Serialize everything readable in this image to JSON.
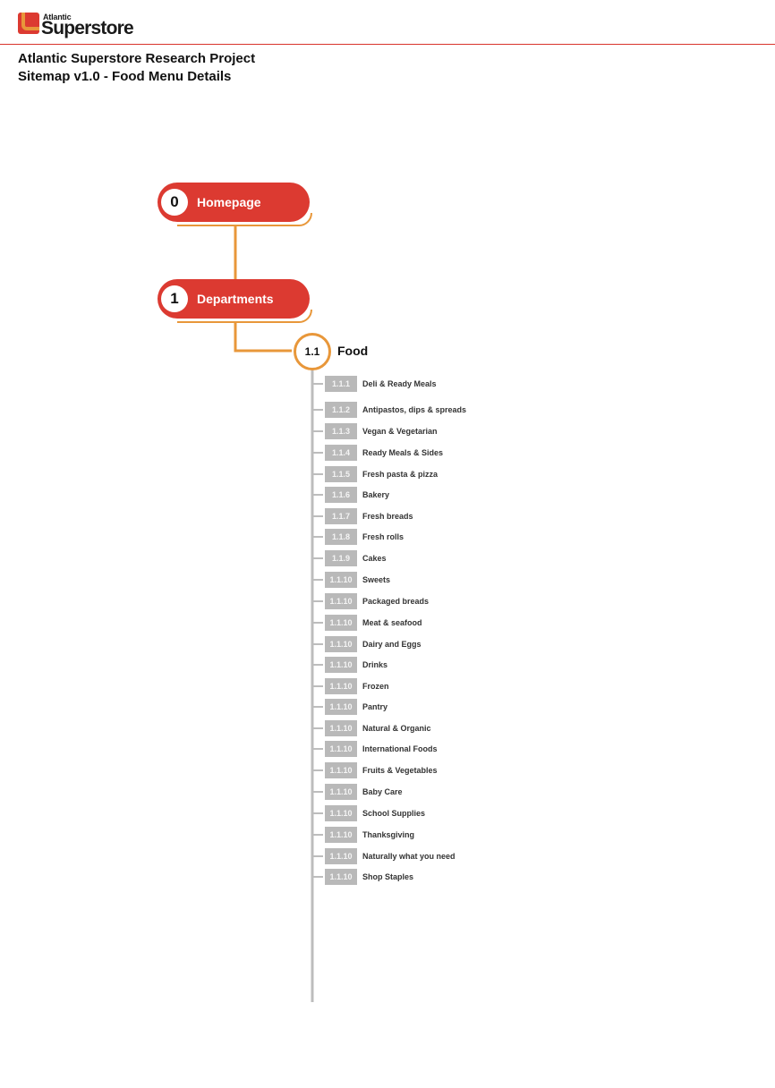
{
  "header": {
    "logo_small": "Atlantic",
    "logo_big": "Superstore",
    "title_line1": "Atlantic Superstore Research Project",
    "title_line2": "Sitemap v1.0 - Food Menu Details"
  },
  "colors": {
    "brand_red": "#dc3a31",
    "accent_orange": "#e8973a",
    "badge_grey": "#b9b9b9",
    "line_grey": "#bdbdbd"
  },
  "nodes": {
    "homepage": {
      "num": "0",
      "label": "Homepage"
    },
    "departments": {
      "num": "1",
      "label": "Departments"
    },
    "food": {
      "num": "1.1",
      "label": "Food"
    }
  },
  "items": [
    {
      "code": "1.1.1",
      "label": "Deli & Ready Meals"
    },
    {
      "code": "1.1.2",
      "label": "Antipastos, dips & spreads"
    },
    {
      "code": "1.1.3",
      "label": "Vegan & Vegetarian"
    },
    {
      "code": "1.1.4",
      "label": "Ready Meals & Sides"
    },
    {
      "code": "1.1.5",
      "label": "Fresh pasta & pizza"
    },
    {
      "code": "1.1.6",
      "label": "Bakery"
    },
    {
      "code": "1.1.7",
      "label": "Fresh breads"
    },
    {
      "code": "1.1.8",
      "label": "Fresh rolls"
    },
    {
      "code": "1.1.9",
      "label": "Cakes"
    },
    {
      "code": "1.1.10",
      "label": "Sweets"
    },
    {
      "code": "1.1.10",
      "label": "Packaged breads"
    },
    {
      "code": "1.1.10",
      "label": "Meat & seafood"
    },
    {
      "code": "1.1.10",
      "label": "Dairy and Eggs"
    },
    {
      "code": "1.1.10",
      "label": "Drinks"
    },
    {
      "code": "1.1.10",
      "label": "Frozen"
    },
    {
      "code": "1.1.10",
      "label": "Pantry"
    },
    {
      "code": "1.1.10",
      "label": "Natural & Organic"
    },
    {
      "code": "1.1.10",
      "label": "International Foods"
    },
    {
      "code": "1.1.10",
      "label": "Fruits & Vegetables"
    },
    {
      "code": "1.1.10",
      "label": "Baby Care"
    },
    {
      "code": "1.1.10",
      "label": "School Supplies"
    },
    {
      "code": "1.1.10",
      "label": "Thanksgiving"
    },
    {
      "code": "1.1.10",
      "label": "Naturally what you need"
    },
    {
      "code": "1.1.10",
      "label": "Shop Staples"
    }
  ]
}
